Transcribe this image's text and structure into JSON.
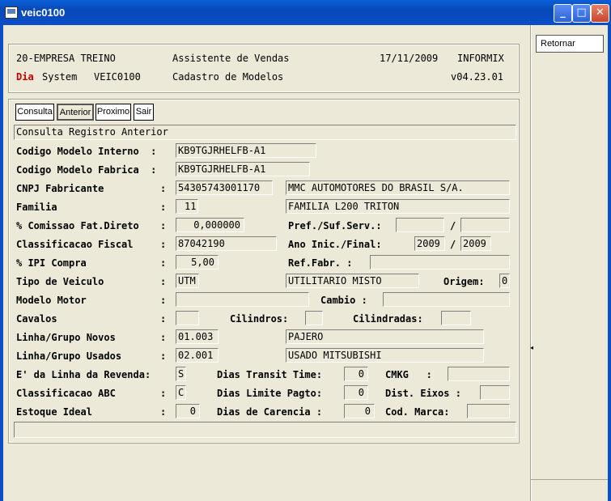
{
  "window": {
    "title": "veic0100",
    "minimize": "_",
    "maximize": "□",
    "close": "✕"
  },
  "header": {
    "company": "20-EMPRESA TREINO",
    "app_title": "Assistente de Vendas",
    "date": "17/11/2009",
    "vendor": "INFORMIX",
    "dia": "Dia",
    "system": "System",
    "program": "VEIC0100",
    "screen_title": "Cadastro de Modelos",
    "version": "v04.23.01"
  },
  "tabs": [
    {
      "label": "Consulta"
    },
    {
      "label": "Anterior"
    },
    {
      "label": "Proximo"
    },
    {
      "label": "Sair"
    }
  ],
  "side": {
    "retornar": "Retornar"
  },
  "status_line": "Consulta Registro Anterior",
  "labels": {
    "cod_interno": "Codigo Modelo Interno  :",
    "cod_fabrica": "Codigo Modelo Fabrica  :",
    "cnpj": "CNPJ Fabricante",
    "familia": "Familia",
    "comissao": "% Comissao Fat.Direto",
    "classif_fiscal": "Classificacao Fiscal",
    "ipi": "% IPI Compra",
    "tipo_veiculo": "Tipo de Veiculo",
    "modelo_motor": "Modelo Motor",
    "cavalos": "Cavalos",
    "linha_novos": "Linha/Grupo Novos",
    "linha_usados": "Linha/Grupo Usados",
    "e_linha_revenda": "E' da Linha da Revenda:",
    "classif_abc": "Classificacao ABC",
    "estoque_ideal": "Estoque Ideal",
    "colon": ":",
    "pref_suf": "Pref./Suf.Serv.:",
    "slash": "/",
    "ano_inic_final": "Ano Inic./Final:",
    "ref_fabr": "Ref.Fabr. :",
    "origem": "Origem:",
    "cambio": "Cambio :",
    "cilindros": "Cilindros:",
    "cilindradas": "Cilindradas:",
    "dias_transit": "Dias Transit Time:",
    "dias_limite": "Dias Limite Pagto:",
    "dias_carencia": "Dias de Carencia :",
    "cmkg": "CMKG   :",
    "dist_eixos": "Dist. Eixos :",
    "cod_marca": "Cod. Marca:"
  },
  "values": {
    "cod_interno": "KB9TGJRHELFB-A1",
    "cod_fabrica": "KB9TGJRHELFB-A1",
    "cnpj": "54305743001170",
    "fabricante_nome": "MMC AUTOMOTORES DO BRASIL S/A.",
    "familia": "11",
    "familia_nome": "FAMILIA L200 TRITON",
    "comissao": "0,000000",
    "pref_serv": "",
    "suf_serv": "",
    "classif_fiscal": "87042190",
    "ano_inicial": "2009",
    "ano_final": "2009",
    "ipi": "5,00",
    "ref_fabr": "",
    "tipo_veiculo": "UTM",
    "tipo_veiculo_nome": "UTILITARIO MISTO",
    "origem": "0",
    "modelo_motor": "",
    "cambio": "",
    "cavalos": "",
    "cilindros": "",
    "cilindradas": "",
    "linha_novos": "01.003",
    "linha_novos_nome": "PAJERO",
    "linha_usados": "02.001",
    "linha_usados_nome": "USADO MITSUBISHI",
    "e_linha_revenda": "S",
    "dias_transit": "0",
    "cmkg": "",
    "classif_abc": "C",
    "dias_limite": "0",
    "dist_eixos": "",
    "estoque_ideal": "0",
    "dias_carencia": "0",
    "cod_marca": ""
  },
  "colors": {
    "dia_red": "#C00000",
    "titlebar_blue": "#0A4EC8"
  }
}
